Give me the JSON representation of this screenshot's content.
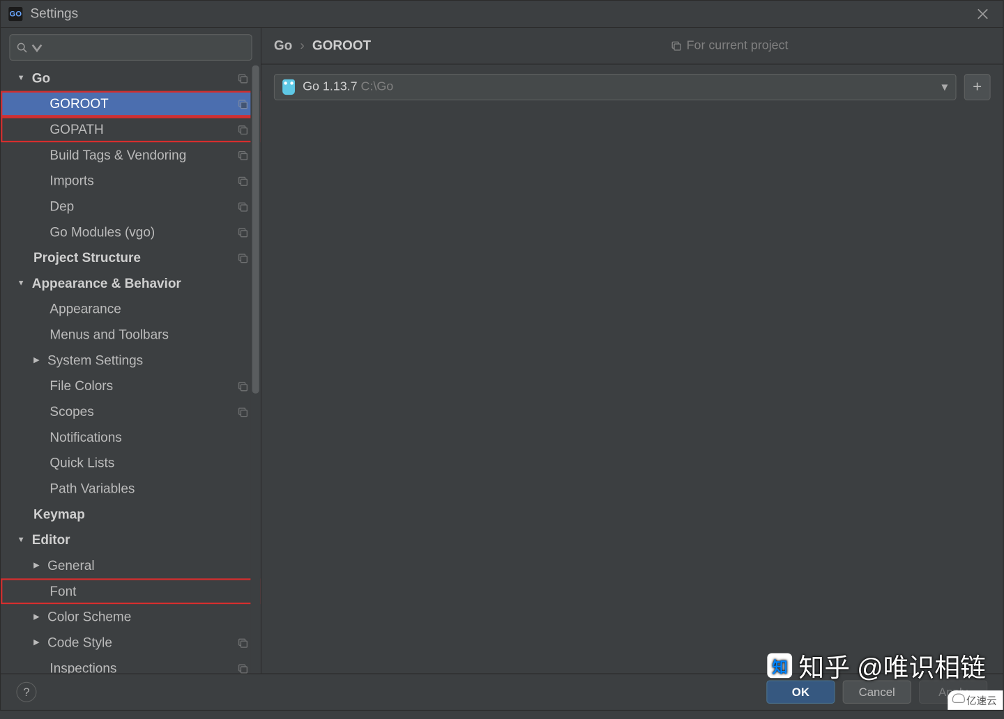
{
  "window": {
    "title": "Settings"
  },
  "tree": [
    {
      "label": "Go",
      "level": 0,
      "expandable": true,
      "expanded": true,
      "bold": true,
      "copy": true,
      "selected": false,
      "highlight": false
    },
    {
      "label": "GOROOT",
      "level": 2,
      "expandable": false,
      "expanded": false,
      "bold": false,
      "copy": true,
      "selected": true,
      "highlight": true
    },
    {
      "label": "GOPATH",
      "level": 2,
      "expandable": false,
      "expanded": false,
      "bold": false,
      "copy": true,
      "selected": false,
      "highlight": true
    },
    {
      "label": "Build Tags & Vendoring",
      "level": 2,
      "expandable": false,
      "expanded": false,
      "bold": false,
      "copy": true,
      "selected": false,
      "highlight": false
    },
    {
      "label": "Imports",
      "level": 2,
      "expandable": false,
      "expanded": false,
      "bold": false,
      "copy": true,
      "selected": false,
      "highlight": false
    },
    {
      "label": "Dep",
      "level": 2,
      "expandable": false,
      "expanded": false,
      "bold": false,
      "copy": true,
      "selected": false,
      "highlight": false
    },
    {
      "label": "Go Modules (vgo)",
      "level": 2,
      "expandable": false,
      "expanded": false,
      "bold": false,
      "copy": true,
      "selected": false,
      "highlight": false
    },
    {
      "label": "Project Structure",
      "level": 0,
      "expandable": false,
      "expanded": false,
      "bold": true,
      "copy": true,
      "selected": false,
      "highlight": false,
      "noarr": true
    },
    {
      "label": "Appearance & Behavior",
      "level": 0,
      "expandable": true,
      "expanded": true,
      "bold": true,
      "copy": false,
      "selected": false,
      "highlight": false
    },
    {
      "label": "Appearance",
      "level": 2,
      "expandable": false,
      "expanded": false,
      "bold": false,
      "copy": false,
      "selected": false,
      "highlight": false
    },
    {
      "label": "Menus and Toolbars",
      "level": 2,
      "expandable": false,
      "expanded": false,
      "bold": false,
      "copy": false,
      "selected": false,
      "highlight": false
    },
    {
      "label": "System Settings",
      "level": 1,
      "expandable": true,
      "expanded": false,
      "bold": false,
      "copy": false,
      "selected": false,
      "highlight": false
    },
    {
      "label": "File Colors",
      "level": 2,
      "expandable": false,
      "expanded": false,
      "bold": false,
      "copy": true,
      "selected": false,
      "highlight": false
    },
    {
      "label": "Scopes",
      "level": 2,
      "expandable": false,
      "expanded": false,
      "bold": false,
      "copy": true,
      "selected": false,
      "highlight": false
    },
    {
      "label": "Notifications",
      "level": 2,
      "expandable": false,
      "expanded": false,
      "bold": false,
      "copy": false,
      "selected": false,
      "highlight": false
    },
    {
      "label": "Quick Lists",
      "level": 2,
      "expandable": false,
      "expanded": false,
      "bold": false,
      "copy": false,
      "selected": false,
      "highlight": false
    },
    {
      "label": "Path Variables",
      "level": 2,
      "expandable": false,
      "expanded": false,
      "bold": false,
      "copy": false,
      "selected": false,
      "highlight": false
    },
    {
      "label": "Keymap",
      "level": 0,
      "expandable": false,
      "expanded": false,
      "bold": true,
      "copy": false,
      "selected": false,
      "highlight": false,
      "noarr": true
    },
    {
      "label": "Editor",
      "level": 0,
      "expandable": true,
      "expanded": true,
      "bold": true,
      "copy": false,
      "selected": false,
      "highlight": false
    },
    {
      "label": "General",
      "level": 1,
      "expandable": true,
      "expanded": false,
      "bold": false,
      "copy": false,
      "selected": false,
      "highlight": false
    },
    {
      "label": "Font",
      "level": 2,
      "expandable": false,
      "expanded": false,
      "bold": false,
      "copy": false,
      "selected": false,
      "highlight": true
    },
    {
      "label": "Color Scheme",
      "level": 1,
      "expandable": true,
      "expanded": false,
      "bold": false,
      "copy": false,
      "selected": false,
      "highlight": false
    },
    {
      "label": "Code Style",
      "level": 1,
      "expandable": true,
      "expanded": false,
      "bold": false,
      "copy": true,
      "selected": false,
      "highlight": false
    },
    {
      "label": "Inspections",
      "level": 2,
      "expandable": false,
      "expanded": false,
      "bold": false,
      "copy": true,
      "selected": false,
      "highlight": false
    }
  ],
  "breadcrumb": {
    "root": "Go",
    "sep": "›",
    "current": "GOROOT"
  },
  "context_hint": "For current project",
  "sdk": {
    "label": "Go 1.13.7",
    "path": "C:\\Go"
  },
  "buttons": {
    "ok": "OK",
    "cancel": "Cancel",
    "apply": "Apply",
    "help": "?",
    "add": "+"
  },
  "watermark": {
    "brand": "知",
    "text": "知乎 @唯识相链",
    "corner": "亿速云"
  }
}
